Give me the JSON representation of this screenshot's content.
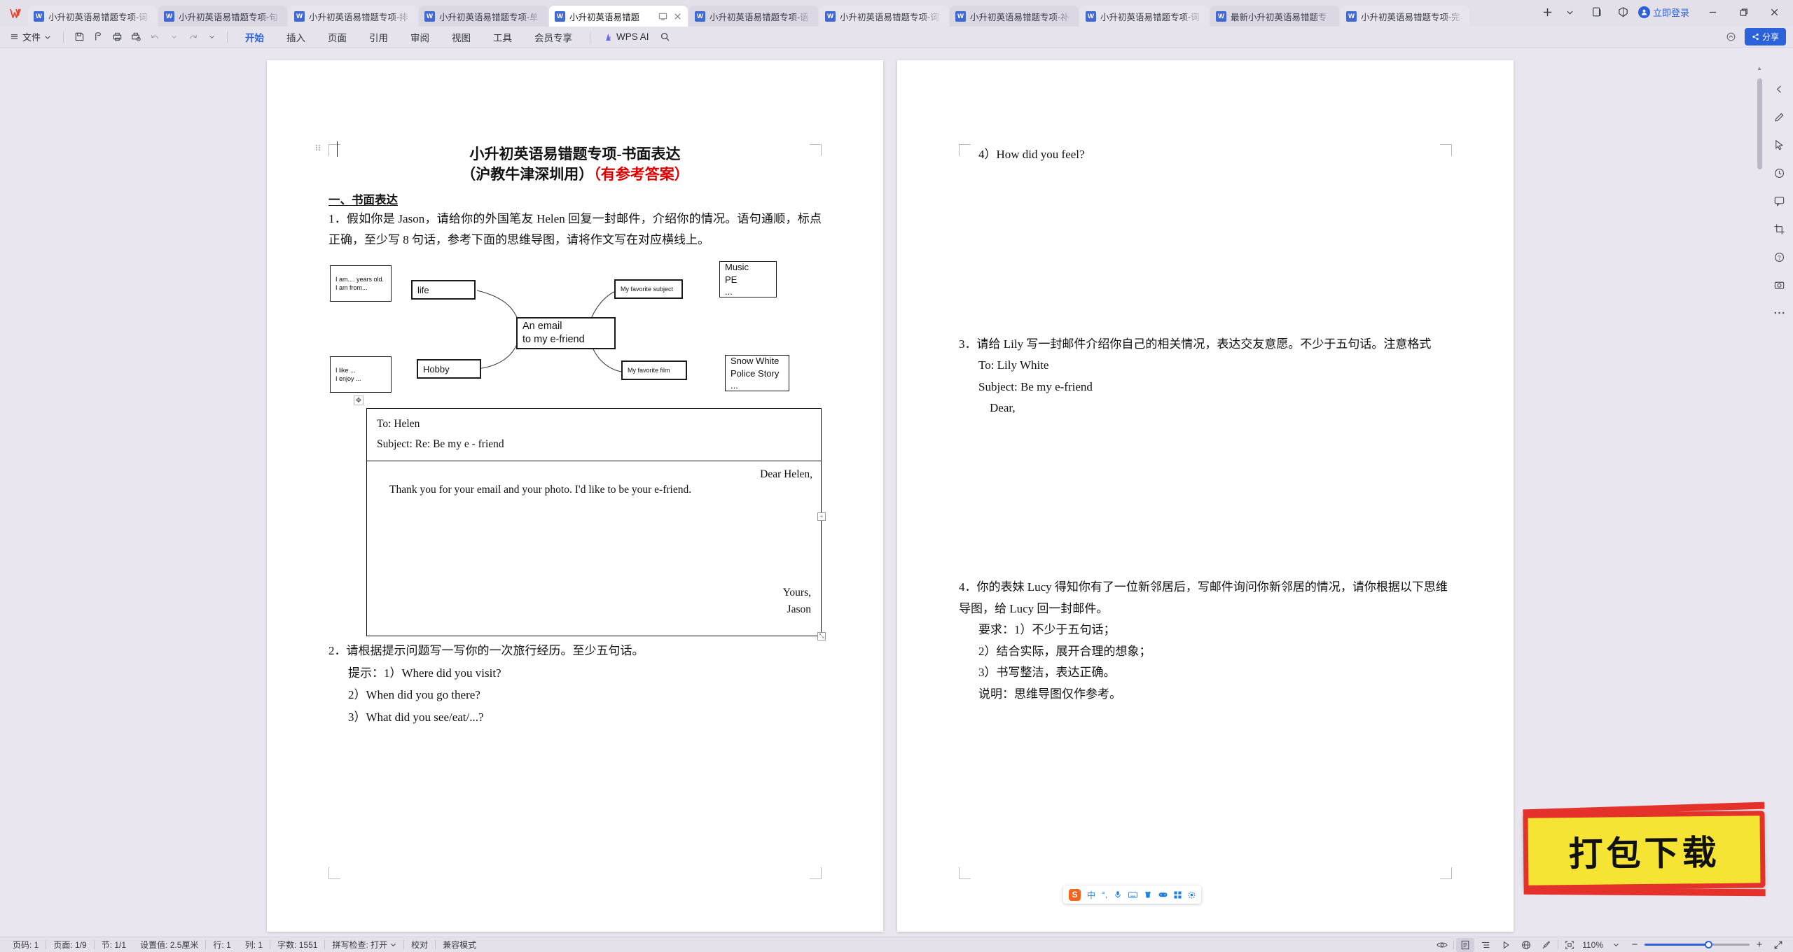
{
  "app": {
    "logo": "wps-logo",
    "login_label": "立即登录"
  },
  "tabs": [
    {
      "label": "小升初英语易错题专项-词",
      "active": false
    },
    {
      "label": "小升初英语易错题专项-句",
      "active": false
    },
    {
      "label": "小升初英语易错题专项-排",
      "active": false
    },
    {
      "label": "小升初英语易错题专项-单",
      "active": false
    },
    {
      "label": "小升初英语易错题",
      "active": true
    },
    {
      "label": "小升初英语易错题专项-语",
      "active": false
    },
    {
      "label": "小升初英语易错题专项-词",
      "active": false
    },
    {
      "label": "小升初英语易错题专项-补",
      "active": false
    },
    {
      "label": "小升初英语易错题专项-词",
      "active": false
    },
    {
      "label": "最新小升初英语易错题专",
      "active": false
    },
    {
      "label": "小升初英语易错题专项-完",
      "active": false
    }
  ],
  "ribbon": {
    "file_label": "文件",
    "menu_tabs": [
      "开始",
      "插入",
      "页面",
      "引用",
      "审阅",
      "视图",
      "工具",
      "会员专享"
    ],
    "active_menu_tab": "开始",
    "ai_label": "WPS AI",
    "share_label": "分享"
  },
  "document": {
    "title_line1": "小升初英语易错题专项-书面表达",
    "title_line2_black": "（沪教牛津深圳用）",
    "title_line2_red": "（有参考答案）",
    "section_heading": "一、书面表达",
    "q1": "1．假如你是 Jason，请给你的外国笔友 Helen 回复一封邮件，介绍你的情况。语句通顺，标点正确，至少写 8 句话，参考下面的思维导图，请将作文写在对应横线上。",
    "mindmap": {
      "center": [
        "An email",
        "to my e-friend"
      ],
      "node_life": "life",
      "node_hobby": "Hobby",
      "node_subject": "My favorite subject",
      "node_film": "My favorite film",
      "leaf_life": [
        "I am.... years old.",
        "I am from..."
      ],
      "leaf_hobby": [
        "I like ...",
        "I enjoy ..."
      ],
      "leaf_subject": [
        "Music",
        "PE",
        "..."
      ],
      "leaf_film": [
        "Snow White",
        "Police Story",
        "..."
      ]
    },
    "email": {
      "to": "To: Helen",
      "subject": "Subject: Re: Be my e - friend",
      "greeting": "Dear Helen,",
      "body": "Thank you for your email and your photo. I'd like to be your e-friend.",
      "sign1": "Yours,",
      "sign2": "Jason"
    },
    "q2": "2．请根据提示问题写一写你的一次旅行经历。至少五句话。",
    "q2_hints": [
      "提示：1）Where did you visit?",
      "2）When did you go there?",
      "3）What did you see/eat/...?"
    ],
    "page2": {
      "q2_hint4": "4）How did you feel?",
      "q3": "3．请给 Lily 写一封邮件介绍你自己的相关情况，表达交友意愿。不少于五句话。注意格式",
      "q3_to": "To: Lily White",
      "q3_subject": "Subject: Be my e-friend",
      "q3_dear": "Dear,",
      "q4": "4．你的表妹 Lucy 得知你有了一位新邻居后，写邮件询问你新邻居的情况，请你根据以下思维导图，给 Lucy 回一封邮件。",
      "q4_reqs": [
        "要求：1）不少于五句话；",
        "2）结合实际，展开合理的想象；",
        "3）书写整洁，表达正确。",
        "说明：思维导图仅作参考。"
      ]
    }
  },
  "ime": {
    "logo": "S",
    "mode": "中",
    "items": [
      "half-width-icon",
      "microphone-icon",
      "keyboard-icon",
      "skin-icon",
      "game-icon",
      "apps-icon",
      "settings-icon"
    ]
  },
  "watermark": {
    "text": "打包下载"
  },
  "statusbar": {
    "page_no": "页码: 1",
    "page_count": "页面: 1/9",
    "section": "节: 1/1",
    "setting": "设置值: 2.5厘米",
    "row": "行: 1",
    "col": "列: 1",
    "words": "字数: 1551",
    "spellcheck": "拼写检查: 打开",
    "proof": "校对",
    "compat": "兼容模式",
    "zoom": "110%"
  },
  "colors": {
    "accent": "#2b62d9",
    "title_red": "#e00000",
    "stamp_yellow": "#f5e433",
    "stamp_red": "#e4322b"
  }
}
